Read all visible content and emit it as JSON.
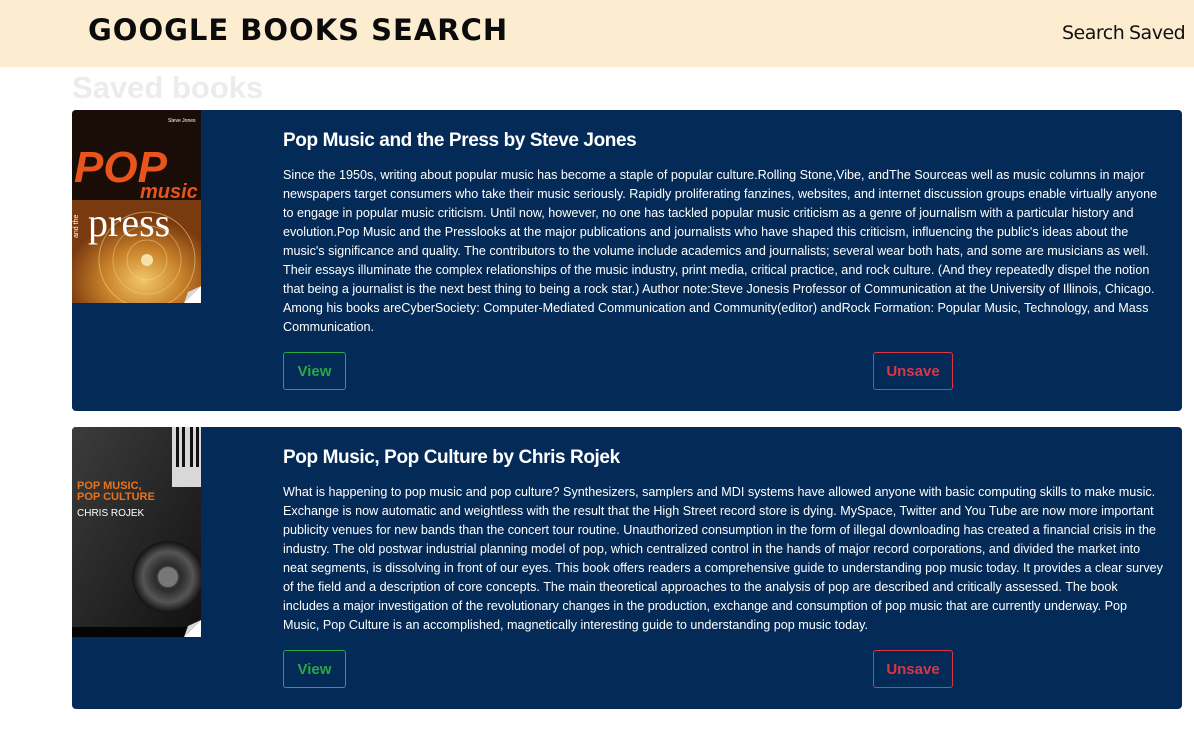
{
  "navbar": {
    "brand": "GOOGLE BOOKS SEARCH",
    "links": [
      "Search",
      "Saved"
    ]
  },
  "page": {
    "heading": "Saved books"
  },
  "books": [
    {
      "title": "Pop Music and the Press by Steve Jones",
      "description": "Since the 1950s, writing about popular music has become a staple of popular culture.Rolling Stone,Vibe, andThe Sourceas well as music columns in major newspapers target consumers who take their music seriously. Rapidly proliferating fanzines, websites, and internet discussion groups enable virtually anyone to engage in popular music criticism. Until now, however, no one has tackled popular music criticism as a genre of journalism with a particular history and evolution.Pop Music and the Presslooks at the major publications and journalists who have shaped this criticism, influencing the public's ideas about the music's significance and quality. The contributors to the volume include academics and journalists; several wear both hats, and some are musicians as well. Their essays illuminate the complex relationships of the music industry, print media, critical practice, and rock culture. (And they repeatedly dispel the notion that being a journalist is the next best thing to being a rock star.) Author note:Steve Jonesis Professor of Communication at the University of Illinois, Chicago. Among his books areCyberSociety: Computer-Mediated Communication and Community(editor) andRock Formation: Popular Music, Technology, and Mass Communication.",
      "view_label": "View",
      "unsave_label": "Unsave",
      "cover": {
        "author": "Steve Jones",
        "line1": "POP",
        "line2": "music",
        "line3": "and the",
        "line4": "press"
      }
    },
    {
      "title": "Pop Music, Pop Culture by Chris Rojek",
      "description": "What is happening to pop music and pop culture? Synthesizers, samplers and MDI systems have allowed anyone with basic computing skills to make music. Exchange is now automatic and weightless with the result that the High Street record store is dying. MySpace, Twitter and You Tube are now more important publicity venues for new bands than the concert tour routine. Unauthorized consumption in the form of illegal downloading has created a financial crisis in the industry. The old postwar industrial planning model of pop, which centralized control in the hands of major record corporations, and divided the market into neat segments, is dissolving in front of our eyes. This book offers readers a comprehensive guide to understanding pop music today. It provides a clear survey of the field and a description of core concepts. The main theoretical approaches to the analysis of pop are described and critically assessed. The book includes a major investigation of the revolutionary changes in the production, exchange and consumption of pop music that are currently underway. Pop Music, Pop Culture is an accomplished, magnetically interesting guide to understanding pop music today.",
      "view_label": "View",
      "unsave_label": "Unsave",
      "cover": {
        "line1": "POP MUSIC,",
        "line2": "POP CULTURE",
        "author": "CHRIS ROJEK"
      }
    }
  ],
  "colors": {
    "navbar_bg": "#fcecd0",
    "card_bg": "#042b58",
    "view": "#28a745",
    "unsave": "#dc3545"
  }
}
